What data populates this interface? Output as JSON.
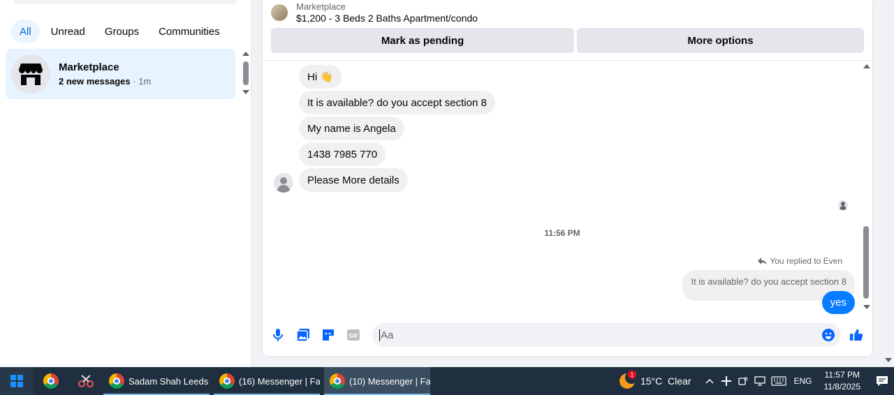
{
  "filters": [
    "All",
    "Unread",
    "Groups",
    "Communities"
  ],
  "conversation": {
    "name": "Marketplace",
    "new_messages": "2 new messages",
    "time": "· 1m"
  },
  "listing": {
    "label": "Marketplace",
    "title": "$1,200 - 3 Beds 2 Baths Apartment/condo"
  },
  "actions": {
    "pending": "Mark as pending",
    "more": "More options"
  },
  "messages": [
    {
      "text": "Hi 👋"
    },
    {
      "text": "It is available? do you accept section 8"
    },
    {
      "text": "My name is Angela"
    },
    {
      "text": "1438 7985 770"
    },
    {
      "text": "Please More details"
    }
  ],
  "timestamp": "11:56 PM",
  "reply": {
    "label": "You replied to Even",
    "quoted": "It is available? do you accept section 8",
    "message": "yes"
  },
  "composer": {
    "placeholder": "Aa"
  },
  "taskbar": {
    "apps": [
      {
        "label": "Sadam Shah Leeds ..."
      },
      {
        "label": "(16) Messenger | Fa..."
      },
      {
        "label": "(10) Messenger | Fa..."
      }
    ],
    "weather_badge": "1",
    "weather": "15°C  Clear",
    "lang": "ENG",
    "time": "11:57 PM",
    "date": "11/8/2025"
  },
  "colors": {
    "accent": "#0a7cff",
    "filter_active_bg": "#ebf5ff",
    "conversation_selected_bg": "#e7f3ff",
    "taskbar_bg": "#1f2f3f"
  }
}
